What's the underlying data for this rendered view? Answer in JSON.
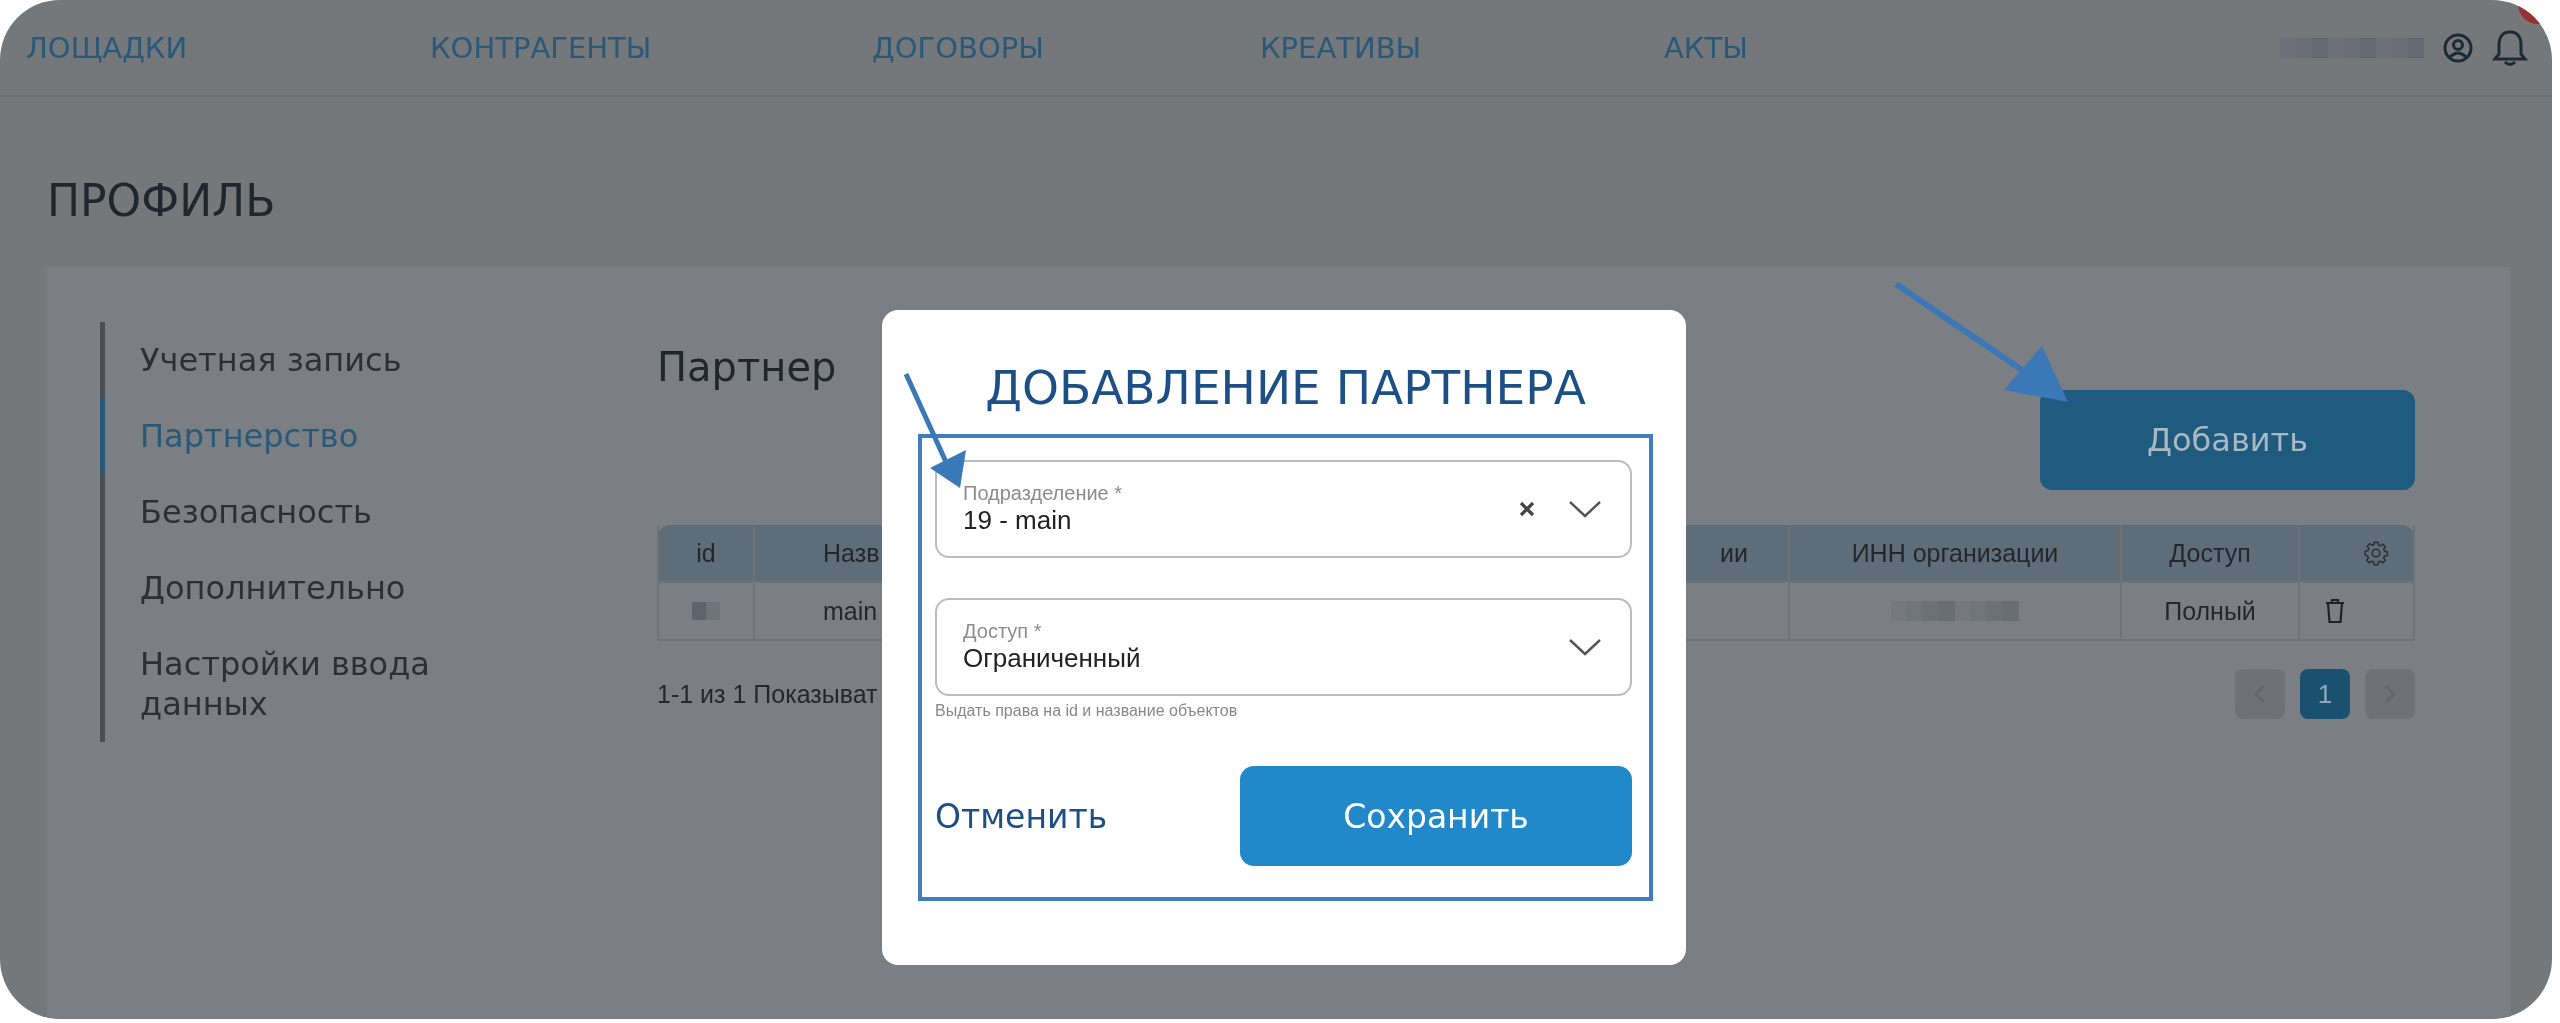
{
  "nav": {
    "items": [
      "ЛОЩАДКИ",
      "КОНТРАГЕНТЫ",
      "ДОГОВОРЫ",
      "КРЕАТИВЫ",
      "АКТЫ"
    ]
  },
  "page_title": "ПРОФИЛЬ",
  "sidebar": {
    "items": [
      {
        "label": "Учетная запись",
        "selected": false
      },
      {
        "label": "Партнерство",
        "selected": true
      },
      {
        "label": "Безопасность",
        "selected": false
      },
      {
        "label": "Дополнительно",
        "selected": false
      },
      {
        "label": "Настройки ввода данных",
        "selected": false
      }
    ]
  },
  "section_title": "Партнер",
  "add_button": "Добавить",
  "table": {
    "columns": [
      "id",
      "Назв",
      "ии",
      "ИНН организации",
      "Доступ"
    ],
    "rows": [
      {
        "name": "main",
        "access": "Полный"
      }
    ]
  },
  "pagination": {
    "summary": "1-1 из 1  Показыват",
    "pages": [
      {
        "label": "1",
        "selected": true
      }
    ]
  },
  "modal": {
    "title": "ДОБАВЛЕНИЕ ПАРТНЕРА",
    "fields": [
      {
        "label": "Подразделение *",
        "value": "19 - main",
        "clearable": true
      },
      {
        "label": "Доступ *",
        "value": "Ограниченный",
        "clearable": false,
        "hint": "Выдать права на id и название объектов"
      }
    ],
    "cancel": "Отменить",
    "save": "Сохранить"
  }
}
